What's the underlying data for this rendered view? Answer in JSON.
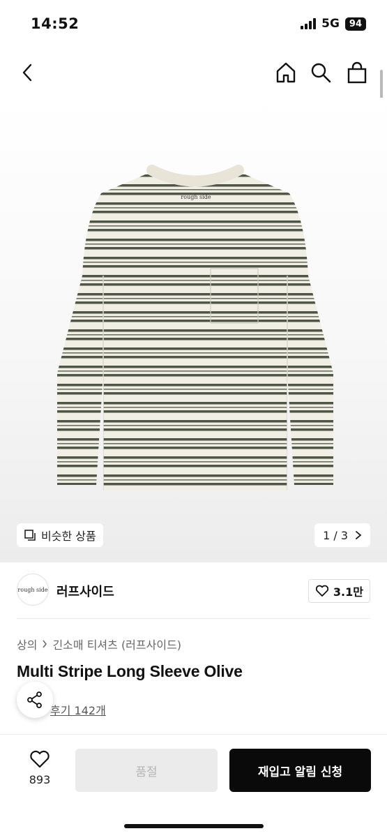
{
  "status": {
    "time": "14:52",
    "network": "5G",
    "battery": "94"
  },
  "nav": {
    "back_icon": "chevron-left-icon",
    "home_icon": "home-icon",
    "search_icon": "search-icon",
    "cart_icon": "shopping-bag-icon"
  },
  "gallery": {
    "similar_label": "비슷한 상품",
    "page_indicator": "1 / 3",
    "logo_text": "rough side"
  },
  "brand": {
    "name": "러프사이드",
    "logo_text": "rough side",
    "likes": "3.1만"
  },
  "breadcrumb": {
    "category": "상의",
    "subcategory": "긴소매 티셔츠 (러프사이드)"
  },
  "product": {
    "title": "Multi Stripe Long Sleeve Olive",
    "reviews": "후기 142개"
  },
  "bottom": {
    "wish_count": "893",
    "soldout_label": "품절",
    "restock_label": "재입고 알림 신청"
  },
  "colors": {
    "stripe_olive": "#4f5646",
    "shirt_base": "#f1efe5",
    "primary_button": "#0a0a0a",
    "disabled_button": "#ebebeb"
  }
}
